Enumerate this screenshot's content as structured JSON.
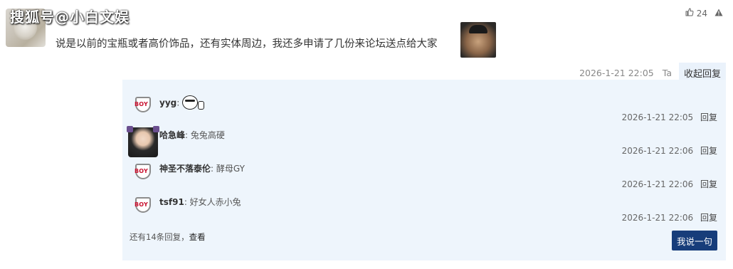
{
  "watermark": "搜狐号@小白文娱",
  "post": {
    "text": "说是以前的宝瓶或者高价饰品，还有实体周边，我还多申请了几份来论坛送点给大家",
    "likes": "24",
    "time": "2026-1-21 22:05",
    "ta": "Ta",
    "collapse_label": "收起回复"
  },
  "replies": [
    {
      "name": "yyg",
      "sep": ":",
      "text": "",
      "time": "2026-1-21 22:05",
      "reply_label": "回复"
    },
    {
      "name": "哈急峰",
      "sep": ":",
      "text": " 兔兔高硬",
      "time": "2026-1-21 22:06",
      "reply_label": "回复"
    },
    {
      "name": "神圣不落泰伦",
      "sep": ":",
      "text": " 酵母GY",
      "time": "2026-1-21 22:06",
      "reply_label": "回复"
    },
    {
      "name": "tsf91",
      "sep": ":",
      "text": " 好女人赤小兔",
      "time": "2026-1-21 22:06",
      "reply_label": "回复"
    }
  ],
  "more": {
    "count_text": "还有14条回复，",
    "view_label": "查看"
  },
  "say_button": "我说一句",
  "badge_text": "BOY",
  "icons": {
    "like": "thumbs-up-icon",
    "report": "warning-icon",
    "logo": "boy-shield-logo-icon"
  },
  "colors": {
    "reply_bg": "#eef5fc",
    "button_bg": "#173d7a",
    "badge_red": "#c8102e"
  }
}
